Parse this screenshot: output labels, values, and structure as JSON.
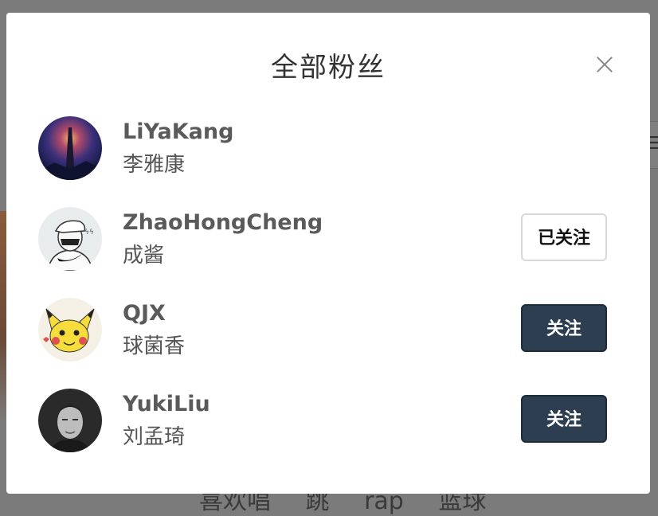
{
  "background": {
    "tags": [
      "喜欢唱",
      "跳",
      "rap",
      "篮球"
    ]
  },
  "modal": {
    "title": "全部粉丝",
    "close_icon": "close-icon"
  },
  "fans": [
    {
      "name": "LiYaKang",
      "nickname": "李雅康",
      "avatar_icon": "avatar-night-tower",
      "button": null
    },
    {
      "name": "ZhaoHongCheng",
      "nickname": "成酱",
      "avatar_icon": "avatar-sketch-cap",
      "button": {
        "label": "已关注",
        "state": "following"
      }
    },
    {
      "name": "QJX",
      "nickname": "球菌香",
      "avatar_icon": "avatar-pikachu",
      "button": {
        "label": "关注",
        "state": "not-following"
      }
    },
    {
      "name": "YukiLiu",
      "nickname": "刘孟琦",
      "avatar_icon": "avatar-portrait-bw",
      "button": {
        "label": "关注",
        "state": "not-following"
      }
    }
  ],
  "colors": {
    "overlay": "#7b7b7b",
    "follow_button_dark": "#2c3e50",
    "name_text": "#5a5a5a"
  }
}
